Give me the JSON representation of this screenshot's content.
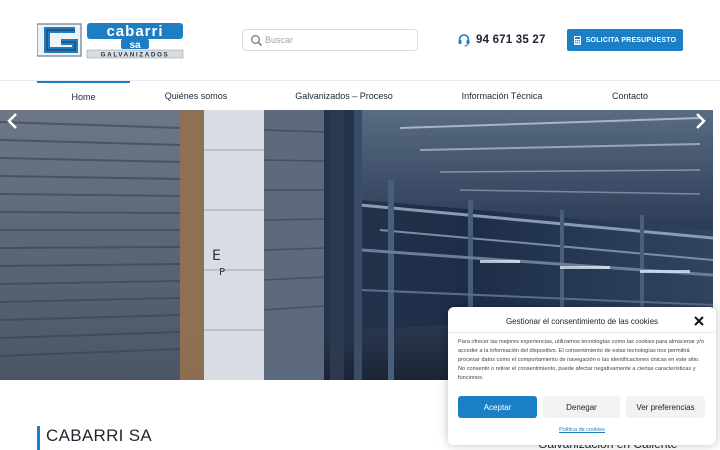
{
  "brand": {
    "logo_wordmark": "cabarri sa",
    "logo_tagline": "GALVANIZADOS",
    "accent_color": "#1a7fc4"
  },
  "search": {
    "placeholder": "Buscar",
    "value": "",
    "icon": "search-icon"
  },
  "contact": {
    "phone": "94 671 35 27",
    "icon": "headset-icon"
  },
  "quote_button": {
    "label": "SOLICITA PRESUPUESTO",
    "icon": "calculator-icon"
  },
  "nav": {
    "items": [
      {
        "label": "Home",
        "active": true
      },
      {
        "label": "Quiénes somos",
        "active": false
      },
      {
        "label": "Galvanizados – Proceso",
        "active": false
      },
      {
        "label": "Información Técnica",
        "active": false
      },
      {
        "label": "Contacto",
        "active": false
      }
    ]
  },
  "hero": {
    "prev_icon": "chevron-left-icon",
    "next_icon": "chevron-right-icon"
  },
  "content": {
    "heading": "CABARRI SA",
    "subheading": "Galvanización en Caliente"
  },
  "cookie": {
    "title": "Gestionar el consentimiento de las cookies",
    "body": "Para ofrecer las mejores experiencias, utilizamos tecnologías como las cookies para almacenar y/o acceder a la información del dispositivo. El consentimiento de estas tecnologías nos permitirá procesar datos como el comportamiento de navegación o las identificaciones únicas en este sitio. No consentir o retirar el consentimiento, puede afectar negativamente a ciertas características y funciones.",
    "accept": "Aceptar",
    "deny": "Denegar",
    "preferences": "Ver preferencias",
    "policy": "Política de cookies",
    "close_icon": "close-icon"
  }
}
